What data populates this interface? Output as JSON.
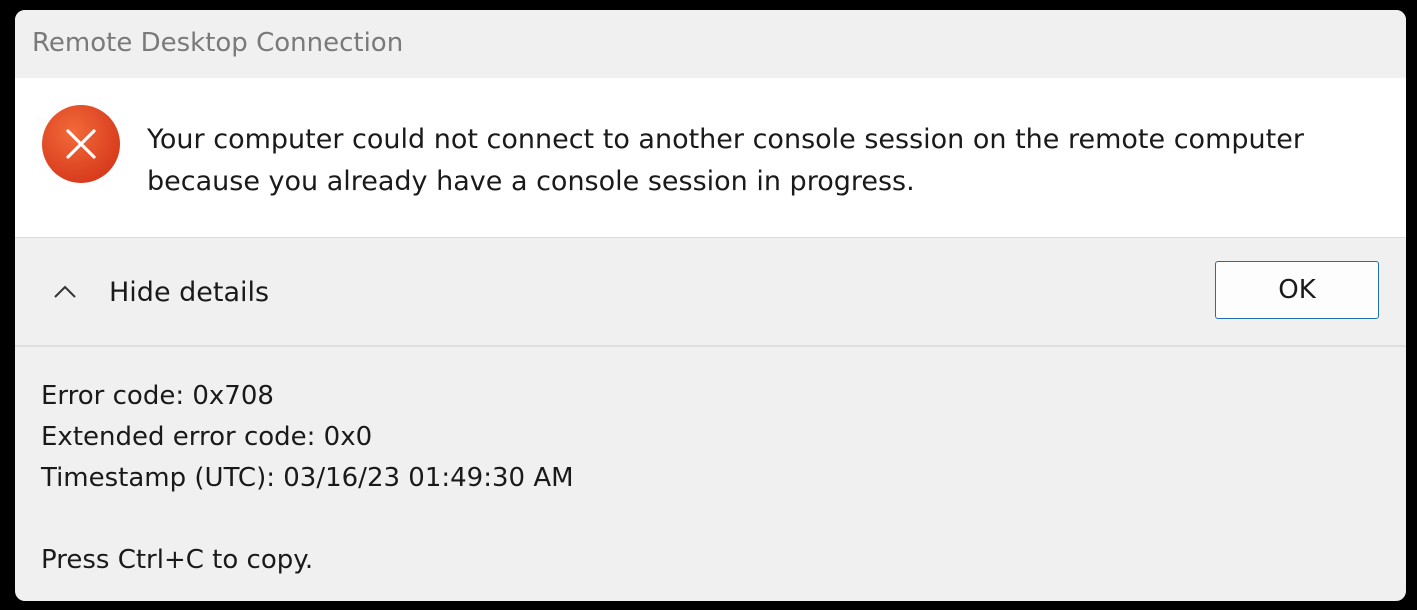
{
  "window": {
    "title": "Remote Desktop Connection"
  },
  "message": {
    "icon": "error-icon",
    "line1": "Your computer could not connect to another console session on the remote computer",
    "line2": "because you already have a console session in progress."
  },
  "actions": {
    "details_toggle_icon": "chevron-up-icon",
    "details_toggle_label": "Hide details",
    "ok_label": "OK"
  },
  "details": {
    "error_code": "Error code: 0x708",
    "extended_error_code": "Extended error code: 0x0",
    "timestamp": "Timestamp (UTC): 03/16/23 01:49:30 AM",
    "copy_hint": "Press Ctrl+C to copy."
  },
  "colors": {
    "error_red": "#e0441c",
    "button_border": "#1f6fb2",
    "title_gray": "#7a7a7a"
  }
}
